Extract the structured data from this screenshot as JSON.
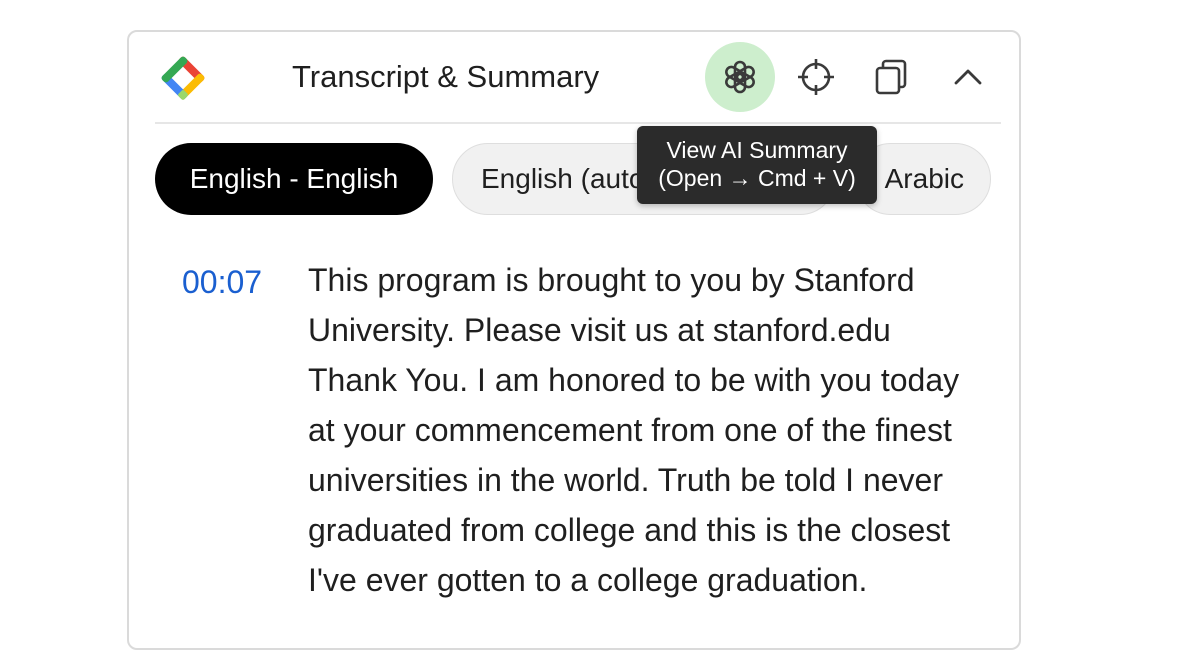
{
  "header": {
    "title": "Transcript & Summary",
    "logo_icon": "colorful-diamond-logo",
    "actions": [
      {
        "name": "ai-summary",
        "icon": "openai-icon",
        "bg": "#cdeecd"
      },
      {
        "name": "locate",
        "icon": "crosshair-icon"
      },
      {
        "name": "copy",
        "icon": "copy-icon"
      },
      {
        "name": "collapse",
        "icon": "chevron-up-icon"
      }
    ]
  },
  "tooltip": {
    "line1": "View AI Summary",
    "line2": "(Open → Cmd + V)"
  },
  "languages": {
    "active": "English - English",
    "auto": "English (auto-generated)",
    "arabic": "Arabic"
  },
  "transcript": {
    "timestamp": "00:07",
    "text": "This program is brought to you by Stanford University. Please visit us at stanford.edu Thank You. I am honored to be with you today at your commencement from one of the finest universities in the world. Truth be told I never graduated from college and this is the closest I've ever gotten to a college graduation."
  },
  "colors": {
    "accent_timestamp": "#1a5fd0",
    "chip_active_bg": "#000000",
    "ai_button_bg": "#cdeecd"
  }
}
